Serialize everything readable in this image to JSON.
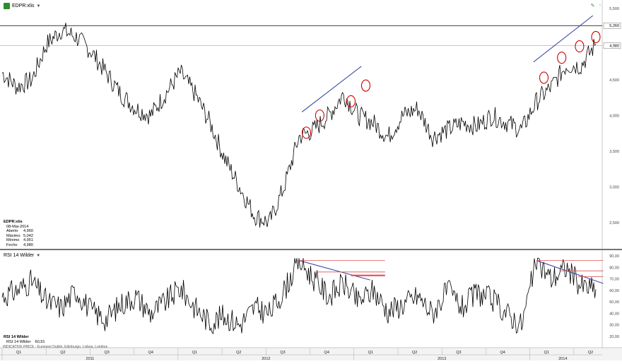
{
  "main_panel": {
    "symbol_label": "EDPR:xlis",
    "axis_ticks": [
      "5,500",
      "5,000",
      "4,500",
      "4,000",
      "3,500",
      "3,000",
      "2,500"
    ],
    "badge_upper": "5,260",
    "badge_lower": "4,980",
    "info": {
      "title": "EDPR:xlis",
      "date": "08-Mai-2014",
      "rows": [
        {
          "label": "Aberto",
          "value": "4,960"
        },
        {
          "label": "Máximo",
          "value": "5,042"
        },
        {
          "label": "Mínimo",
          "value": "4,951"
        },
        {
          "label": "Fecho",
          "value": "4,980"
        }
      ]
    }
  },
  "rsi_panel": {
    "title": "RSI 14 Wilder",
    "axis_ticks": [
      "90,00",
      "80,00",
      "70,00",
      "60,00",
      "50,00",
      "40,00",
      "30,00",
      "20,00"
    ],
    "info_title": "RSI 14 Wilder",
    "info_label": "RSI 14 Wilder",
    "info_value": "60,91"
  },
  "provider_note": "INDICATIVE PRICE - Euronext Dublin, Edinburgo, Lisboa, Londres",
  "time_axis": {
    "quarters": [
      "Q1",
      "Q2",
      "Q3",
      "Q4",
      "Q1",
      "Q2",
      "Q3",
      "Q4",
      "Q1",
      "Q2",
      "Q3",
      "Q4",
      "Q1",
      "Q2"
    ],
    "years": [
      "2011",
      "2012",
      "2013",
      "2014"
    ]
  },
  "colors": {
    "price": "#000000",
    "trendline": "#2b3a9e",
    "circle": "#d00000",
    "level_line": "#e8a090",
    "upper_line": "#000000",
    "rsi_red": "#e05050"
  },
  "chart_data": {
    "type": "line",
    "title": "EDPR:xlis",
    "ylim": [
      2.2,
      5.55
    ],
    "x": [
      "2011-01",
      "2011-02",
      "2011-03",
      "2011-04",
      "2011-05",
      "2011-06",
      "2011-07",
      "2011-08",
      "2011-09",
      "2011-10",
      "2011-11",
      "2011-12",
      "2012-01",
      "2012-02",
      "2012-03",
      "2012-04",
      "2012-05",
      "2012-06",
      "2012-07",
      "2012-08",
      "2012-09",
      "2012-10",
      "2012-11",
      "2012-12",
      "2013-01",
      "2013-02",
      "2013-03",
      "2013-04",
      "2013-05",
      "2013-06",
      "2013-07",
      "2013-08",
      "2013-09",
      "2013-10",
      "2013-11",
      "2013-12",
      "2014-01",
      "2014-02",
      "2014-03",
      "2014-04",
      "2014-05"
    ],
    "series": [
      {
        "values": [
          4.6,
          4.4,
          4.5,
          5.0,
          5.2,
          5.1,
          4.9,
          4.6,
          4.3,
          4.1,
          4.0,
          4.3,
          4.6,
          4.3,
          3.9,
          3.4,
          3.0,
          2.6,
          2.5,
          3.0,
          3.7,
          3.8,
          4.0,
          4.3,
          4.0,
          3.9,
          3.7,
          4.0,
          4.1,
          3.7,
          3.8,
          3.9,
          3.85,
          4.0,
          3.9,
          3.8,
          4.2,
          4.4,
          4.7,
          4.7,
          5.0
        ]
      }
    ],
    "horizontal_levels": [
      5.26,
      4.98
    ],
    "rsi": {
      "name": "RSI 14 Wilder",
      "ylim": [
        20,
        90
      ],
      "values": [
        55,
        60,
        68,
        50,
        45,
        60,
        42,
        35,
        48,
        55,
        40,
        50,
        62,
        45,
        32,
        38,
        30,
        45,
        40,
        60,
        86,
        70,
        55,
        66,
        50,
        60,
        42,
        48,
        55,
        40,
        60,
        45,
        58,
        52,
        40,
        30,
        86,
        70,
        80,
        64,
        60.91
      ]
    },
    "annotations": {
      "red_circle_peaks": 9,
      "trendlines": 4
    }
  }
}
